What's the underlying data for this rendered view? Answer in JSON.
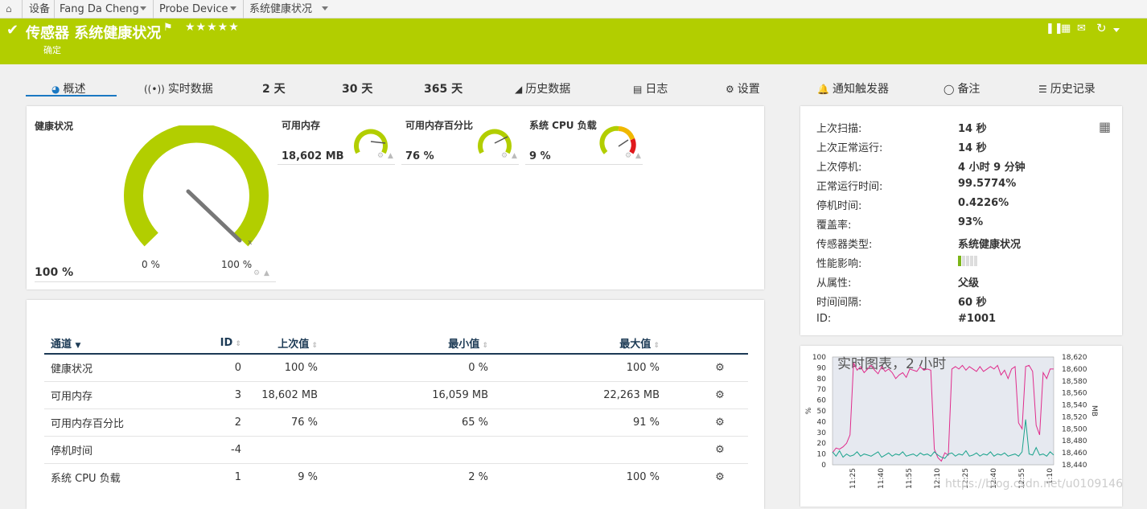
{
  "breadcrumb": {
    "home_icon": "home-icon",
    "items": [
      "设备",
      "Fang Da Cheng",
      "Probe Device",
      "系统健康状况"
    ]
  },
  "header": {
    "title": "传感器 系统健康状况",
    "status": "确定",
    "stars": "★★★★★",
    "color": "#b2ce00"
  },
  "tabs": [
    {
      "label": "概述",
      "icon": "gauge-icon"
    },
    {
      "label": "实时数据",
      "icon": "broadcast-icon"
    },
    {
      "label": "2  天",
      "icon": ""
    },
    {
      "label": "30 天",
      "icon": ""
    },
    {
      "label": "365 天",
      "icon": ""
    },
    {
      "label": "历史数据",
      "icon": "area-chart-icon"
    },
    {
      "label": "日志",
      "icon": "list-icon"
    },
    {
      "label": "设置",
      "icon": "gear-icon"
    },
    {
      "label": "通知触发器",
      "icon": "bell-icon"
    },
    {
      "label": "备注",
      "icon": "comment-icon"
    },
    {
      "label": "历史记录",
      "icon": "history-icon"
    }
  ],
  "gauges": {
    "main": {
      "label": "健康状况",
      "value": "100 %",
      "min": "0 %",
      "max": "100 %",
      "level": 1.0
    },
    "small": [
      {
        "label": "可用内存",
        "value": "18,602 MB"
      },
      {
        "label": "可用内存百分比",
        "value": "76 %"
      },
      {
        "label": "系统 CPU 负载",
        "value": "9 %"
      }
    ]
  },
  "channels": {
    "headers": [
      "通道",
      "ID",
      "上次值",
      "最小值",
      "最大值"
    ],
    "rows": [
      {
        "name": "健康状况",
        "id": "0",
        "last": "100 %",
        "min": "0 %",
        "max": "100 %"
      },
      {
        "name": "可用内存",
        "id": "3",
        "last": "18,602 MB",
        "min": "16,059 MB",
        "max": "22,263 MB"
      },
      {
        "name": "可用内存百分比",
        "id": "2",
        "last": "76 %",
        "min": "65 %",
        "max": "91 %"
      },
      {
        "name": "停机时间",
        "id": "-4",
        "last": "",
        "min": "",
        "max": ""
      },
      {
        "name": "系统 CPU 负载",
        "id": "1",
        "last": "9 %",
        "min": "2 %",
        "max": "100 %"
      }
    ]
  },
  "info": [
    {
      "label": "上次扫描:",
      "value": "14 秒"
    },
    {
      "label": "上次正常运行:",
      "value": "14 秒"
    },
    {
      "label": "上次停机:",
      "value": "4 小时 9 分钟"
    },
    {
      "label": "正常运行时间:",
      "value": "99.5774%"
    },
    {
      "label": "停机时间:",
      "value": "0.4226%"
    },
    {
      "label": "覆盖率:",
      "value": "93%"
    },
    {
      "label": "传感器类型:",
      "value": "系统健康状况"
    },
    {
      "label": "性能影响:",
      "value": ""
    },
    {
      "label": "从属性:",
      "value": "父级"
    },
    {
      "label": "时间间隔:",
      "value": "60 秒"
    },
    {
      "label": "ID:",
      "value": "#1001"
    }
  ],
  "chart_data": {
    "type": "line",
    "title": "实时图表，2 小时",
    "ylabel": "%",
    "ylabel_right": "MB",
    "ylim": [
      0,
      100
    ],
    "ylim_right": [
      18440,
      18620
    ],
    "yticks": [
      0,
      10,
      20,
      30,
      40,
      50,
      60,
      70,
      80,
      90,
      100
    ],
    "yticks_right": [
      18440,
      18460,
      18480,
      18500,
      18520,
      18540,
      18560,
      18580,
      18600,
      18620
    ],
    "xticks": [
      "11:25",
      "11:40",
      "11:55",
      "12:10",
      "12:25",
      "12:40",
      "12:55",
      "1:10"
    ],
    "series": [
      {
        "axis": "right",
        "color": "#e02c8c",
        "values": [
          18460,
          18468,
          18466,
          18470,
          18476,
          18490,
          18610,
          18598,
          18604,
          18594,
          18600,
          18606,
          18598,
          18592,
          18604,
          18596,
          18600,
          18594,
          18584,
          18590,
          18594,
          18586,
          18600,
          18598,
          18596,
          18604,
          18598,
          18600,
          18598,
          18466,
          18452,
          18446,
          18460,
          18456,
          18600,
          18604,
          18600,
          18606,
          18598,
          18604,
          18600,
          18596,
          18604,
          18596,
          18600,
          18604,
          18600,
          18606,
          18590,
          18598,
          18584,
          18600,
          18604,
          18510,
          18500,
          18604,
          18606,
          18596,
          18506,
          18490,
          18594,
          18584,
          18600,
          18600
        ]
      },
      {
        "axis": "left",
        "color": "#1aa38c",
        "values": [
          12,
          8,
          13,
          7,
          10,
          8,
          9,
          12,
          8,
          10,
          9,
          8,
          10,
          12,
          7,
          9,
          11,
          8,
          10,
          9,
          12,
          8,
          9,
          10,
          8,
          11,
          9,
          10,
          8,
          12,
          9,
          7,
          6,
          10,
          11,
          8,
          10,
          9,
          13,
          8,
          9,
          11,
          8,
          10,
          9,
          12,
          8,
          10,
          9,
          11,
          8,
          9,
          10,
          8,
          12,
          42,
          10,
          9,
          16,
          9,
          10,
          8,
          12,
          9
        ]
      }
    ]
  },
  "watermark": "https://blog.csdn.net/u010914634"
}
